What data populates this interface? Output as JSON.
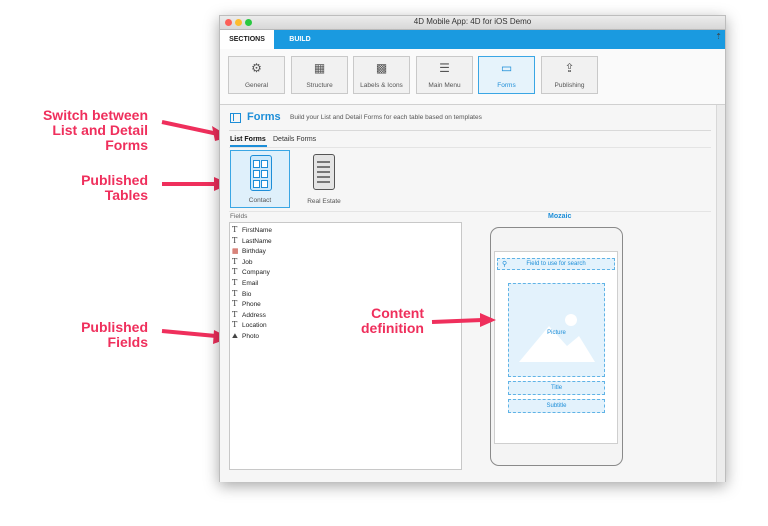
{
  "window": {
    "title": "4D Mobile App: 4D for iOS Demo"
  },
  "section_tabs": [
    "SECTIONS",
    "BUILD"
  ],
  "toolbar": [
    {
      "label": "General",
      "icon": "⚙"
    },
    {
      "label": "Structure",
      "icon": "▦"
    },
    {
      "label": "Labels & Icons",
      "icon": "▩"
    },
    {
      "label": "Main Menu",
      "icon": "☰"
    },
    {
      "label": "Forms",
      "icon": "▭"
    },
    {
      "label": "Publishing",
      "icon": "⇪"
    }
  ],
  "forms_header": {
    "title": "Forms",
    "description": "Build your List and Detail Forms for each table based on templates"
  },
  "form_tabs": [
    "List Forms",
    "Details Forms"
  ],
  "tables": [
    "Contact",
    "Real Estate"
  ],
  "fields_label": "Fields",
  "fields": [
    {
      "name": "FirstName",
      "type": "text"
    },
    {
      "name": "LastName",
      "type": "text"
    },
    {
      "name": "Birthday",
      "type": "date"
    },
    {
      "name": "Job",
      "type": "text"
    },
    {
      "name": "Company",
      "type": "text"
    },
    {
      "name": "Email",
      "type": "text"
    },
    {
      "name": "Bio",
      "type": "text"
    },
    {
      "name": "Phone",
      "type": "text"
    },
    {
      "name": "Address",
      "type": "text"
    },
    {
      "name": "Location",
      "type": "text"
    },
    {
      "name": "Photo",
      "type": "image"
    }
  ],
  "template": {
    "name": "Mozaic",
    "search_placeholder": "Field to use for search",
    "picture_label": "Picture",
    "title_label": "Title",
    "subtitle_label": "Subtitle"
  },
  "annotations": {
    "switch_forms": [
      "Switch between",
      "List and Detail",
      "Forms"
    ],
    "published_tables": [
      "Published",
      "Tables"
    ],
    "published_fields": [
      "Published",
      "Fields"
    ],
    "content_definition": [
      "Content",
      "definition"
    ]
  },
  "colors": {
    "accent": "#1a9ae0",
    "annotation": "#ef2f5c"
  }
}
